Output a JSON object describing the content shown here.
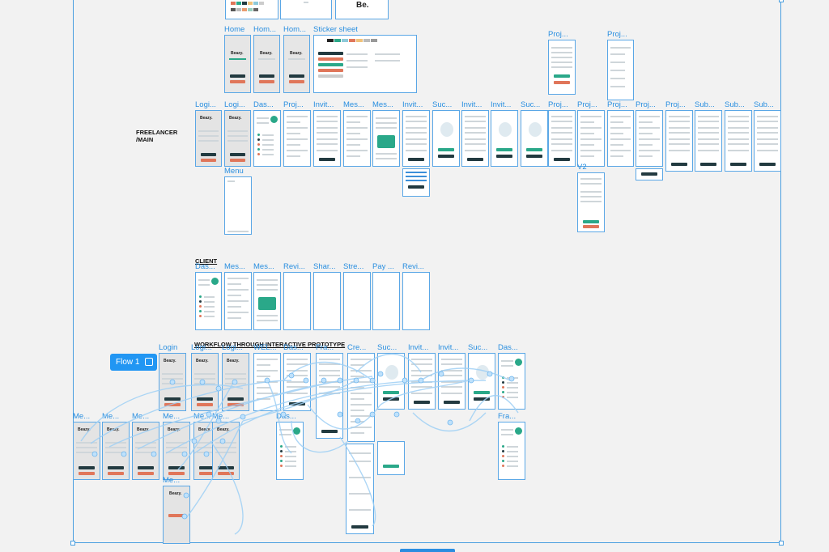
{
  "canvas": {
    "flow_button_label": "Flow 1",
    "sections": {
      "freelancer": "FREELANCER\n/MAIN",
      "client": "CLIENT",
      "workflow": "WORKFLOW THROUGH INTERACTIVE PROTOTYPE"
    }
  },
  "colors": {
    "accent": "#2a8fe0",
    "frame_border": "#5aa7e6",
    "brand_green": "#2aa889",
    "brand_orange": "#e0765a",
    "brand_dark": "#223a40"
  },
  "top_cards": [
    {
      "label": "Be."
    }
  ],
  "row1": [
    {
      "label": "Home"
    },
    {
      "label": "Hom..."
    },
    {
      "label": "Hom..."
    },
    {
      "label": "Sticker sheet"
    }
  ],
  "row1_right": [
    {
      "label": "Proj..."
    },
    {
      "label": "Proj..."
    }
  ],
  "freelancer_row": [
    {
      "label": "Logi..."
    },
    {
      "label": "Logi..."
    },
    {
      "label": "Das..."
    },
    {
      "label": "Proj..."
    },
    {
      "label": "Invit..."
    },
    {
      "label": "Mes..."
    },
    {
      "label": "Mes..."
    },
    {
      "label": "Invit..."
    },
    {
      "label": "Suc..."
    },
    {
      "label": "Invit..."
    },
    {
      "label": "Invit..."
    },
    {
      "label": "Suc..."
    },
    {
      "label": "Proj..."
    },
    {
      "label": "Proj..."
    },
    {
      "label": "Proj..."
    },
    {
      "label": "Proj..."
    },
    {
      "label": "Proj..."
    },
    {
      "label": "Sub..."
    },
    {
      "label": "Sub..."
    },
    {
      "label": "Sub..."
    }
  ],
  "menu_label": "Menu",
  "v2_label": "V2",
  "client_row": [
    {
      "label": "Das..."
    },
    {
      "label": "Mes..."
    },
    {
      "label": "Mes..."
    },
    {
      "label": "Revi..."
    },
    {
      "label": "Shar..."
    },
    {
      "label": "Stre..."
    },
    {
      "label": "Pay ..."
    },
    {
      "label": "Revi..."
    }
  ],
  "workflow_row1": [
    {
      "label": "Login"
    },
    {
      "label": "Logi..."
    },
    {
      "label": "Logi..."
    },
    {
      "label": "WEL..."
    },
    {
      "label": "Das..."
    },
    {
      "label": "Fra..."
    },
    {
      "label": "Cre..."
    },
    {
      "label": "Suc..."
    },
    {
      "label": "Invit..."
    },
    {
      "label": "Invit..."
    },
    {
      "label": "Suc..."
    },
    {
      "label": "Das..."
    }
  ],
  "workflow_row2": [
    {
      "label": "Me..."
    },
    {
      "label": "Me..."
    },
    {
      "label": "Me..."
    },
    {
      "label": "Me..."
    },
    {
      "label": "Me..."
    },
    {
      "label": "Me..."
    },
    {
      "label": "Das..."
    },
    {
      "label": "Fra..."
    }
  ],
  "workflow_menu_bottom": "Me...",
  "brand_word": "Beazy."
}
